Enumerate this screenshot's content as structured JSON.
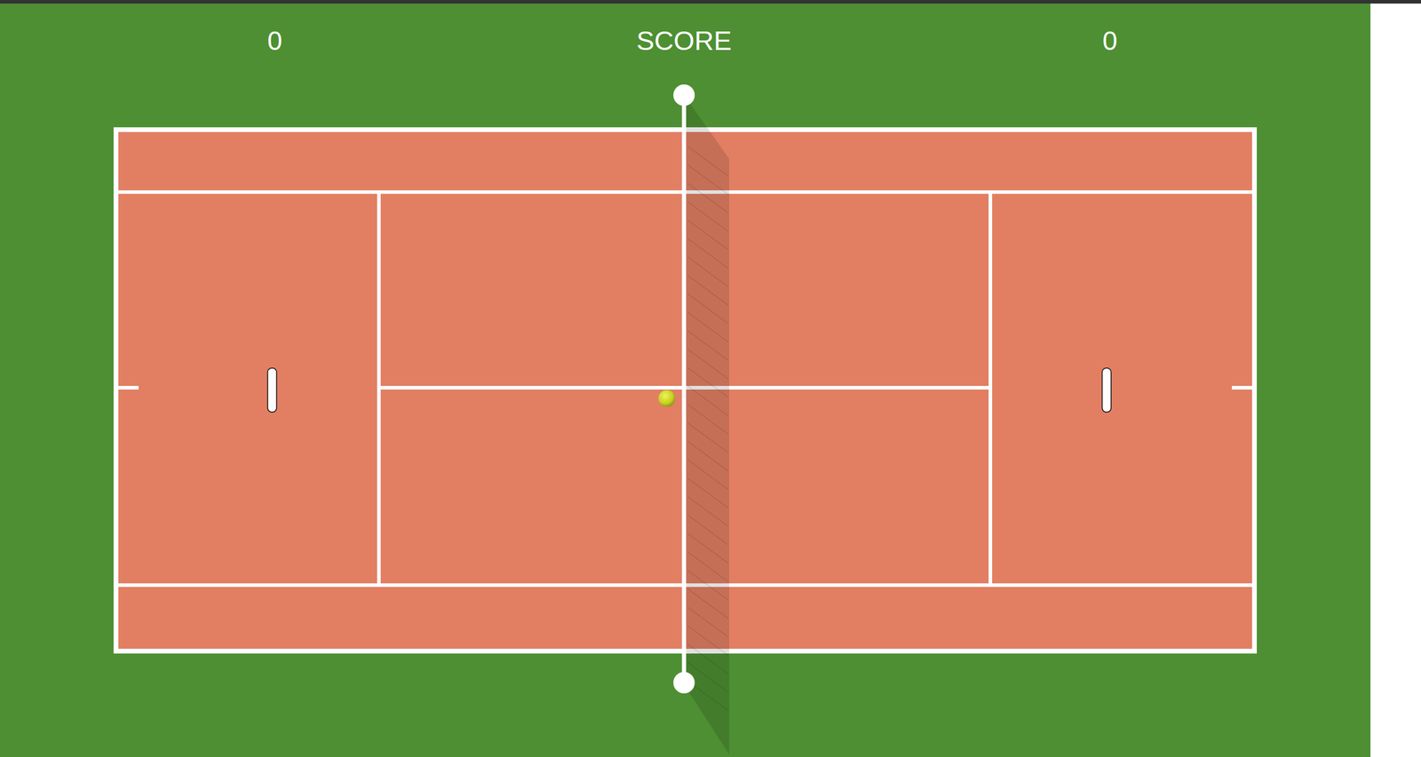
{
  "score": {
    "label": "SCORE",
    "left": "0",
    "right": "0"
  }
}
